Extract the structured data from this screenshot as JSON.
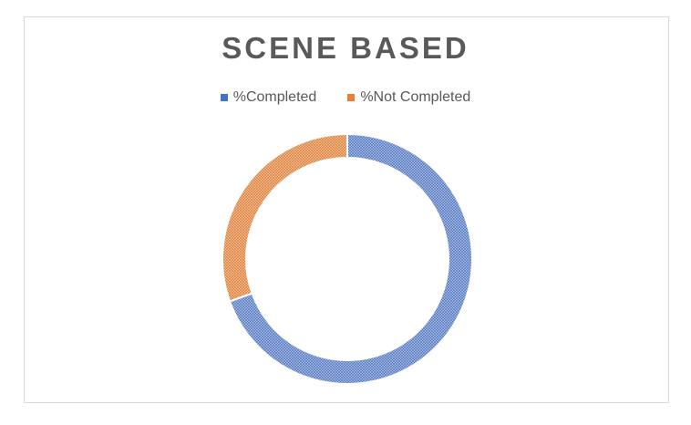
{
  "chart_data": {
    "type": "pie",
    "title": "SCENE BASED",
    "legend_position": "top",
    "donut": true,
    "categories": [
      "%Completed",
      "%Not Completed"
    ],
    "values": [
      69.5,
      30.5
    ],
    "colors": [
      "#4472c4",
      "#ed7d31"
    ]
  }
}
